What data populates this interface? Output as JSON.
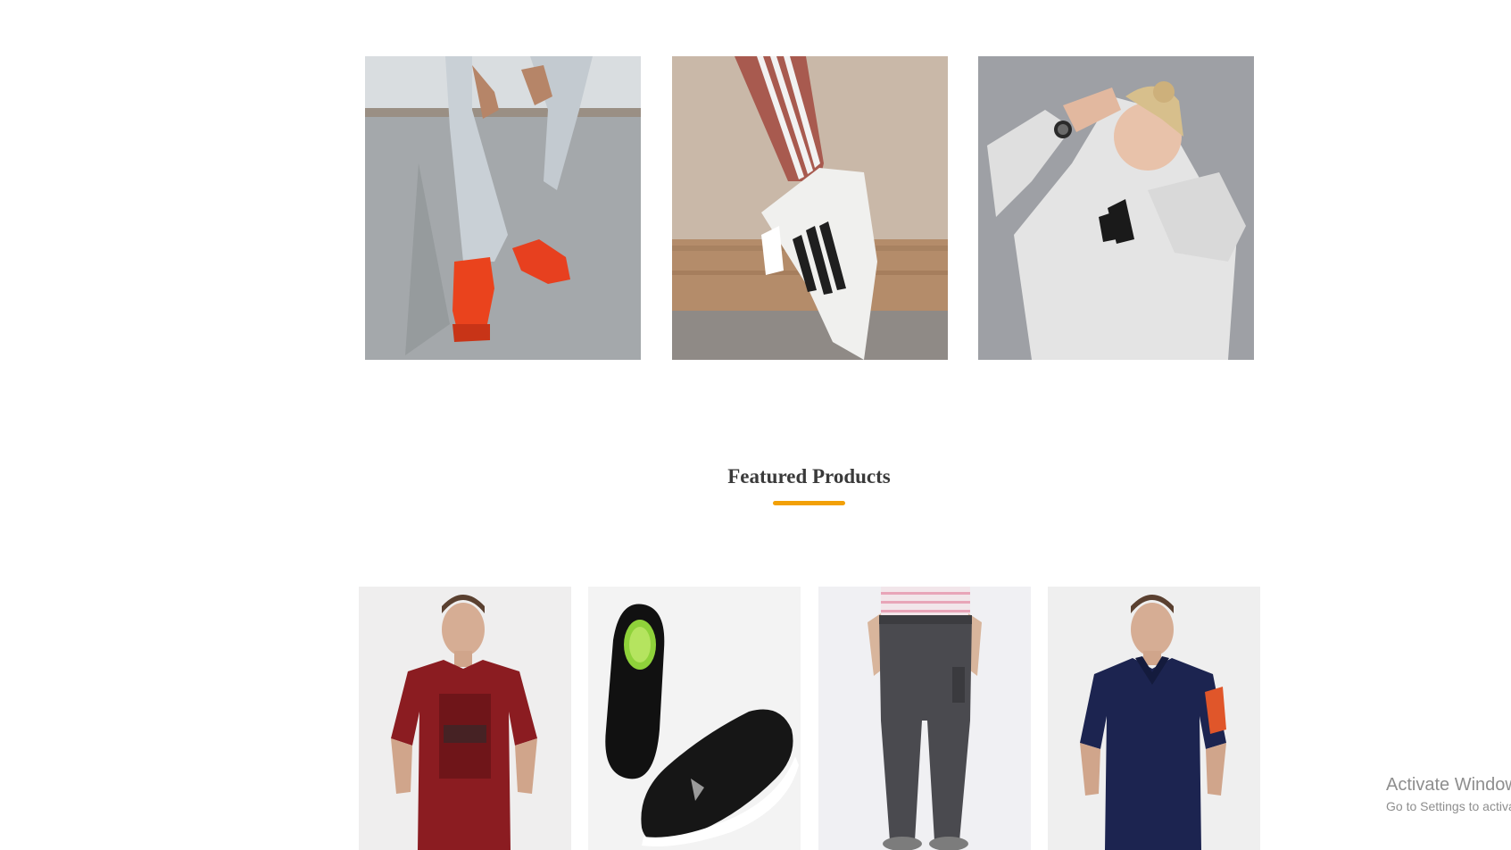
{
  "banners": [
    {
      "icon": "man-sitting-red-sneakers-photo"
    },
    {
      "icon": "striped-pants-white-sneaker-photo"
    },
    {
      "icon": "woman-white-hoodie-photo"
    }
  ],
  "featured": {
    "title": "Featured Products",
    "accent_color": "#f2a007"
  },
  "products": [
    {
      "icon": "maroon-tshirt-photo"
    },
    {
      "icon": "black-sneakers-photo"
    },
    {
      "icon": "grey-joggers-photo"
    },
    {
      "icon": "navy-polo-photo"
    }
  ],
  "os_watermark": {
    "line1": "Activate Windows",
    "line2": "Go to Settings to activate Windows."
  }
}
